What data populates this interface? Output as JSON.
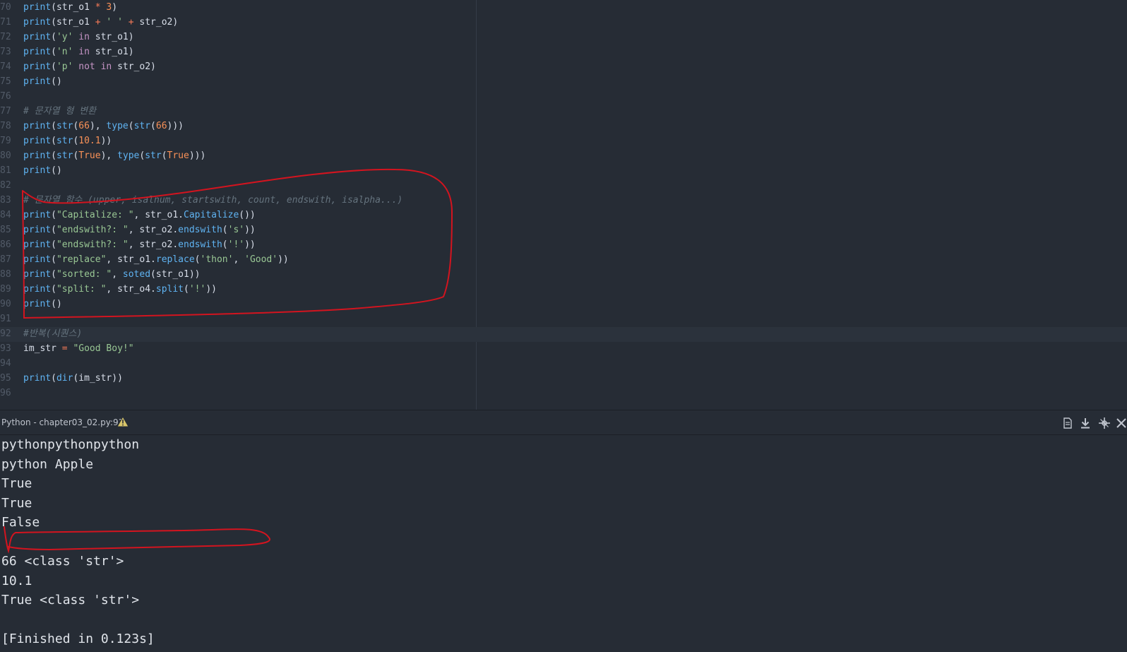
{
  "editor": {
    "lines": [
      {
        "n": "70",
        "tokens": [
          [
            "b",
            "print"
          ],
          [
            "p",
            "(str_o1 "
          ],
          [
            "o",
            "*"
          ],
          [
            "p",
            " "
          ],
          [
            "n",
            "3"
          ],
          [
            "p",
            ")"
          ]
        ]
      },
      {
        "n": "71",
        "tokens": [
          [
            "b",
            "print"
          ],
          [
            "p",
            "(str_o1 "
          ],
          [
            "o",
            "+"
          ],
          [
            "p",
            " "
          ],
          [
            "s",
            "' '"
          ],
          [
            "p",
            " "
          ],
          [
            "o",
            "+"
          ],
          [
            "p",
            " str_o2)"
          ]
        ]
      },
      {
        "n": "72",
        "tokens": [
          [
            "b",
            "print"
          ],
          [
            "p",
            "("
          ],
          [
            "s",
            "'y'"
          ],
          [
            "p",
            " "
          ],
          [
            "k",
            "in"
          ],
          [
            "p",
            " str_o1)"
          ]
        ]
      },
      {
        "n": "73",
        "tokens": [
          [
            "b",
            "print"
          ],
          [
            "p",
            "("
          ],
          [
            "s",
            "'n'"
          ],
          [
            "p",
            " "
          ],
          [
            "k",
            "in"
          ],
          [
            "p",
            " str_o1)"
          ]
        ]
      },
      {
        "n": "74",
        "tokens": [
          [
            "b",
            "print"
          ],
          [
            "p",
            "("
          ],
          [
            "s",
            "'p'"
          ],
          [
            "p",
            " "
          ],
          [
            "k",
            "not"
          ],
          [
            "p",
            " "
          ],
          [
            "k",
            "in"
          ],
          [
            "p",
            " str_o2)"
          ]
        ]
      },
      {
        "n": "75",
        "tokens": [
          [
            "b",
            "print"
          ],
          [
            "p",
            "()"
          ]
        ]
      },
      {
        "n": "76",
        "tokens": []
      },
      {
        "n": "77",
        "tokens": [
          [
            "c",
            "# 문자열 형 변환"
          ]
        ]
      },
      {
        "n": "78",
        "tokens": [
          [
            "b",
            "print"
          ],
          [
            "p",
            "("
          ],
          [
            "b",
            "str"
          ],
          [
            "p",
            "("
          ],
          [
            "n",
            "66"
          ],
          [
            "p",
            "), "
          ],
          [
            "b",
            "type"
          ],
          [
            "p",
            "("
          ],
          [
            "b",
            "str"
          ],
          [
            "p",
            "("
          ],
          [
            "n",
            "66"
          ],
          [
            "p",
            ")))"
          ]
        ]
      },
      {
        "n": "79",
        "tokens": [
          [
            "b",
            "print"
          ],
          [
            "p",
            "("
          ],
          [
            "b",
            "str"
          ],
          [
            "p",
            "("
          ],
          [
            "n",
            "10.1"
          ],
          [
            "p",
            "))"
          ]
        ]
      },
      {
        "n": "80",
        "tokens": [
          [
            "b",
            "print"
          ],
          [
            "p",
            "("
          ],
          [
            "b",
            "str"
          ],
          [
            "p",
            "("
          ],
          [
            "n",
            "True"
          ],
          [
            "p",
            "), "
          ],
          [
            "b",
            "type"
          ],
          [
            "p",
            "("
          ],
          [
            "b",
            "str"
          ],
          [
            "p",
            "("
          ],
          [
            "n",
            "True"
          ],
          [
            "p",
            ")))"
          ]
        ]
      },
      {
        "n": "81",
        "tokens": [
          [
            "b",
            "print"
          ],
          [
            "p",
            "()"
          ]
        ]
      },
      {
        "n": "82",
        "tokens": []
      },
      {
        "n": "83",
        "tokens": [
          [
            "c",
            "# 문자열 함수 (upper, isalnum, startswith, count, endswith, isalpha...)"
          ]
        ]
      },
      {
        "n": "84",
        "tokens": [
          [
            "b",
            "print"
          ],
          [
            "p",
            "("
          ],
          [
            "s",
            "\"Capitalize: \""
          ],
          [
            "p",
            ", str_o1."
          ],
          [
            "b",
            "Capitalize"
          ],
          [
            "p",
            "())"
          ]
        ]
      },
      {
        "n": "85",
        "tokens": [
          [
            "b",
            "print"
          ],
          [
            "p",
            "("
          ],
          [
            "s",
            "\"endswith?: \""
          ],
          [
            "p",
            ", str_o2."
          ],
          [
            "b",
            "endswith"
          ],
          [
            "p",
            "("
          ],
          [
            "s",
            "'s'"
          ],
          [
            "p",
            "))"
          ]
        ]
      },
      {
        "n": "86",
        "tokens": [
          [
            "b",
            "print"
          ],
          [
            "p",
            "("
          ],
          [
            "s",
            "\"endswith?: \""
          ],
          [
            "p",
            ", str_o2."
          ],
          [
            "b",
            "endswith"
          ],
          [
            "p",
            "("
          ],
          [
            "s",
            "'!'"
          ],
          [
            "p",
            "))"
          ]
        ]
      },
      {
        "n": "87",
        "tokens": [
          [
            "b",
            "print"
          ],
          [
            "p",
            "("
          ],
          [
            "s",
            "\"replace\""
          ],
          [
            "p",
            ", str_o1."
          ],
          [
            "b",
            "replace"
          ],
          [
            "p",
            "("
          ],
          [
            "s",
            "'thon'"
          ],
          [
            "p",
            ", "
          ],
          [
            "s",
            "'Good'"
          ],
          [
            "p",
            "))"
          ]
        ]
      },
      {
        "n": "88",
        "tokens": [
          [
            "b",
            "print"
          ],
          [
            "p",
            "("
          ],
          [
            "s",
            "\"sorted: \""
          ],
          [
            "p",
            ", "
          ],
          [
            "b",
            "soted"
          ],
          [
            "p",
            "(str_o1))"
          ]
        ]
      },
      {
        "n": "89",
        "tokens": [
          [
            "b",
            "print"
          ],
          [
            "p",
            "("
          ],
          [
            "s",
            "\"split: \""
          ],
          [
            "p",
            ", str_o4."
          ],
          [
            "b",
            "split"
          ],
          [
            "p",
            "("
          ],
          [
            "s",
            "'!'"
          ],
          [
            "p",
            "))"
          ]
        ]
      },
      {
        "n": "90",
        "tokens": [
          [
            "b",
            "print"
          ],
          [
            "p",
            "()"
          ]
        ]
      },
      {
        "n": "91",
        "tokens": []
      },
      {
        "n": "92",
        "tokens": [
          [
            "c",
            "#반복(시퀀스)"
          ]
        ]
      },
      {
        "n": "93",
        "tokens": [
          [
            "p",
            "im_str "
          ],
          [
            "o",
            "="
          ],
          [
            "p",
            " "
          ],
          [
            "s",
            "\"Good Boy!\""
          ]
        ]
      },
      {
        "n": "94",
        "tokens": []
      },
      {
        "n": "95",
        "tokens": [
          [
            "b",
            "print"
          ],
          [
            "p",
            "("
          ],
          [
            "b",
            "dir"
          ],
          [
            "p",
            "(im_str))"
          ]
        ]
      },
      {
        "n": "96",
        "tokens": []
      }
    ]
  },
  "panel": {
    "title": "Python - chapter03_02.py:91",
    "icons": [
      "file-icon",
      "download-icon",
      "settings-icon",
      "close-icon"
    ]
  },
  "output": {
    "lines": [
      "pythonpythonpython",
      "python Apple",
      "True",
      "True",
      "False",
      "",
      "66 <class 'str'>",
      "10.1",
      "True <class 'str'>",
      "",
      "[Finished in 0.123s]"
    ]
  },
  "colors": {
    "annotation": "#d3141f",
    "background": "#262c35"
  }
}
